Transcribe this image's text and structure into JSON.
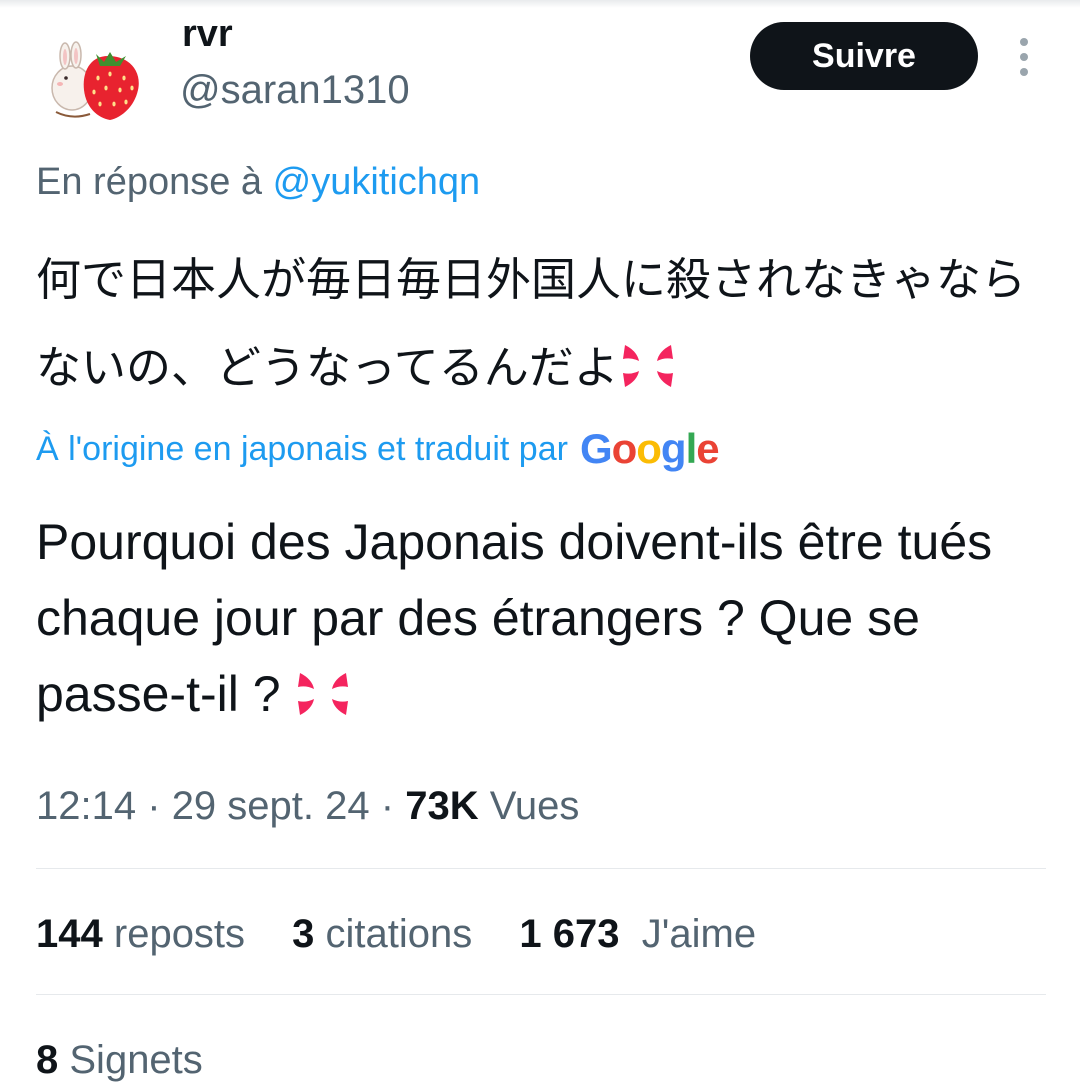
{
  "author": {
    "display_name": "rvr",
    "handle": "@saran1310",
    "avatar_icon": "strawberry-bunny-avatar"
  },
  "follow_button": {
    "label": "Suivre"
  },
  "more_icon": "vertical-ellipsis-icon",
  "reply": {
    "prefix": "En réponse à",
    "mention": "@yukitichqn"
  },
  "tweet": {
    "original_text": "何で日本人が毎日毎日外国人に殺されなきゃならないの、どうなってるんだよ",
    "original_emoji": "anger-symbol-icon",
    "translation_note": "À l'origine en japonais et traduit par",
    "translation_brand": "Google",
    "translated_text": "Pourquoi des Japonais doivent-ils être tués chaque jour par des étrangers ? Que se passe-t-il ?",
    "translated_emoji": "anger-symbol-icon"
  },
  "meta": {
    "time": "12:14",
    "date": "29 sept. 24",
    "views_count": "73K",
    "views_label": "Vues",
    "separator": "·"
  },
  "stats": {
    "reposts_count": "144",
    "reposts_label": "reposts",
    "quotes_count": "3",
    "quotes_label": "citations",
    "likes_count": "1 673",
    "likes_label": "J'aime",
    "bookmarks_count": "8",
    "bookmarks_label": "Signets"
  },
  "colors": {
    "text_primary": "#0f1419",
    "text_secondary": "#536471",
    "link": "#1d9bf0",
    "button_bg": "#0f1419",
    "anger_emoji": "#f4245e"
  }
}
